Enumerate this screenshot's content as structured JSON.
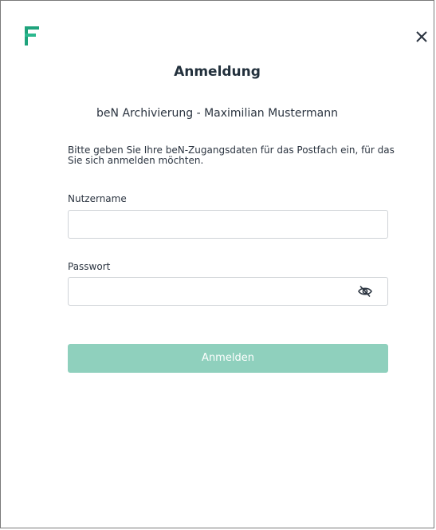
{
  "dialog": {
    "title": "Anmeldung",
    "subtitle": "beN Archivierung - Maximilian Mustermann",
    "info_text": "Bitte geben Sie Ihre beN-Zugangsdaten für das Postfach ein, für das Sie sich anmelden möchten.",
    "logo_icon": "f-logo-icon",
    "close_icon": "close-icon"
  },
  "form": {
    "username": {
      "label": "Nutzername",
      "value": ""
    },
    "password": {
      "label": "Passwort",
      "value": "",
      "toggle_icon": "eye-hidden-icon"
    },
    "submit_label": "Anmelden",
    "submit_enabled": false
  },
  "colors": {
    "accent": "#1fa37c",
    "button_disabled": "#8fd0bd",
    "text": "#2b3440",
    "border": "#cfd3d7"
  }
}
